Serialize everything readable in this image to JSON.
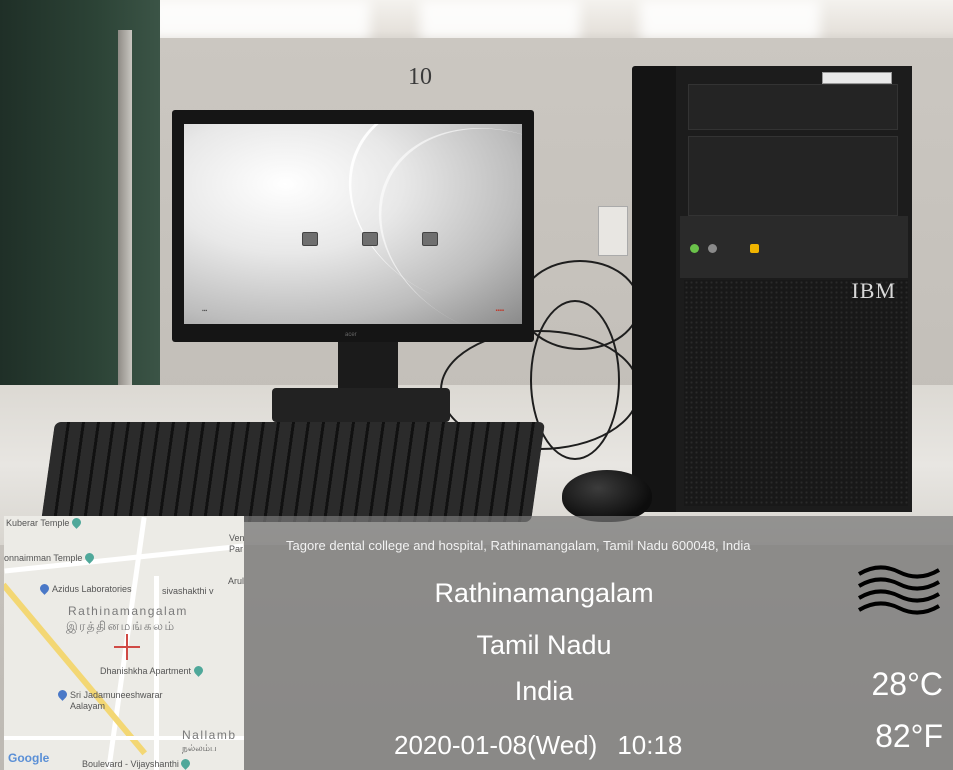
{
  "scene": {
    "wall_number": "10",
    "monitor_brand": "acer",
    "tower_brand": "IBM"
  },
  "map": {
    "labels": {
      "kuberar_temple": "Kuberar Temple",
      "venga": "Venga",
      "par": "Par",
      "ponnaimman_temple": "onnaimman Temple",
      "azidus": "Azidus Laboratories",
      "arul": "Arul",
      "sivashakthi": "sivashakthi v",
      "rathinamangalam_en": "Rathinamangalam",
      "rathinamangalam_ta": "இரத்தினமங்கலம்",
      "dhanishkha": "Dhanishkha Apartment",
      "jadamuneeshwarar": "Sri Jadamuneeshwarar",
      "aalayam": "Aalayam",
      "nallamb": "Nallamb",
      "nallamb_ta": "நல்லம்ப",
      "boulevard": "Boulevard - Vijayshanthi"
    },
    "logo": "Google"
  },
  "location": {
    "address": "Tagore dental college and hospital, Rathinamangalam, Tamil Nadu 600048, India",
    "city": "Rathinamangalam",
    "state": "Tamil Nadu",
    "country": "India",
    "date": "2020-01-08(Wed)",
    "time": "10:18"
  },
  "weather": {
    "icon": "haze-icon",
    "temp_c": "28°C",
    "temp_f": "82°F"
  }
}
